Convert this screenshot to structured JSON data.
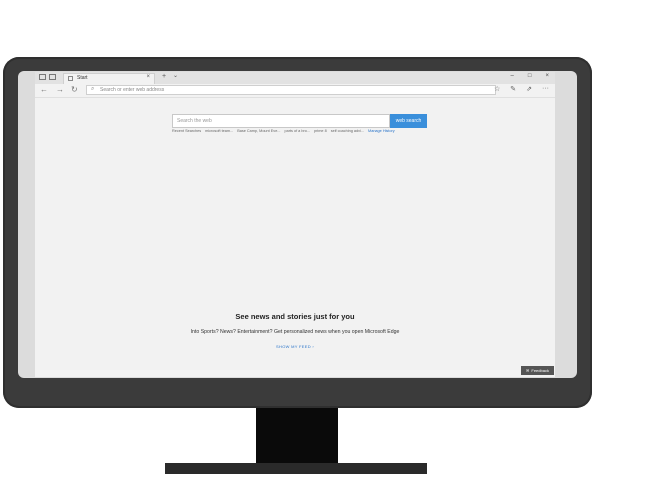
{
  "browser": {
    "tab_title": "Start",
    "tab_close": "×",
    "new_tab": "+",
    "tab_menu": "⌄",
    "window_controls": {
      "minimize": "–",
      "maximize": "□",
      "close": "×"
    },
    "nav": {
      "back": "←",
      "forward": "→",
      "refresh": "↻"
    },
    "address_placeholder": "Search or enter web address",
    "toolbar_icons": [
      "star-icon",
      "pen-icon",
      "share-icon",
      "more-icon"
    ],
    "toolbar_glyphs": {
      "favorites": "☆",
      "notes": "✎",
      "share": "⇗",
      "more": "···"
    }
  },
  "page": {
    "search_placeholder": "Search the web",
    "search_button": "web search",
    "recent": {
      "label": "Recent Searches",
      "items": [
        "microsoft team...",
        "Base Camp, Mount Eve...",
        "parts of a bro...",
        "prime 8",
        "self coaching advi..."
      ],
      "manage": "Manage History"
    },
    "news_title": "See news and stories just for you",
    "news_sub": "Into Sports? News? Entertainment? Get personalized news when you open Microsoft Edge",
    "show_feed": "SHOW MY FEED ›",
    "feedback": "Feedback"
  },
  "colors": {
    "accent": "#3a8fdb",
    "bezel": "#3b3b3b",
    "stand": "#0a0a0a"
  }
}
